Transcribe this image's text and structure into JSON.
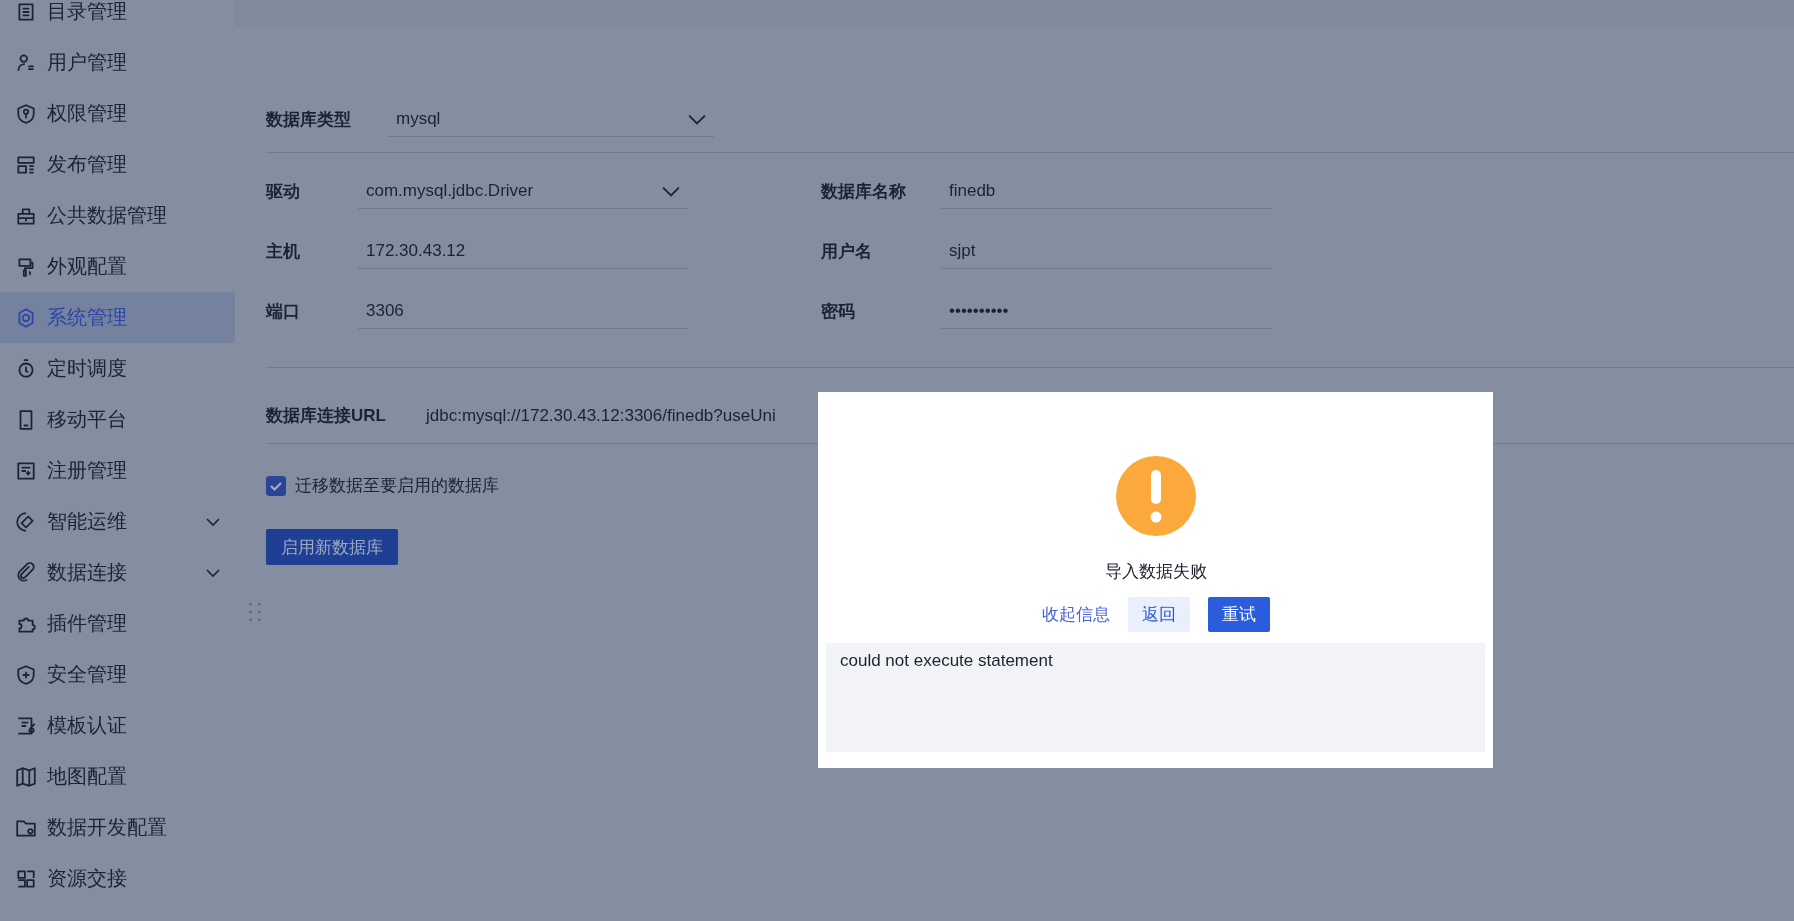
{
  "sidebar": {
    "items": [
      {
        "label": "目录管理",
        "selected": false
      },
      {
        "label": "用户管理",
        "selected": false
      },
      {
        "label": "权限管理",
        "selected": false
      },
      {
        "label": "发布管理",
        "selected": false
      },
      {
        "label": "公共数据管理",
        "selected": false
      },
      {
        "label": "外观配置",
        "selected": false
      },
      {
        "label": "系统管理",
        "selected": true
      },
      {
        "label": "定时调度",
        "selected": false
      },
      {
        "label": "移动平台",
        "selected": false
      },
      {
        "label": "注册管理",
        "selected": false
      },
      {
        "label": "智能运维",
        "selected": false,
        "expanded": false
      },
      {
        "label": "数据连接",
        "selected": false,
        "expanded": false
      },
      {
        "label": "插件管理",
        "selected": false
      },
      {
        "label": "安全管理",
        "selected": false
      },
      {
        "label": "模板认证",
        "selected": false
      },
      {
        "label": "地图配置",
        "selected": false
      },
      {
        "label": "数据开发配置",
        "selected": false
      },
      {
        "label": "资源交接",
        "selected": false
      }
    ]
  },
  "form": {
    "db_type": {
      "label": "数据库类型",
      "value": "mysql"
    },
    "fields": [
      {
        "label": "驱动",
        "value": "com.mysql.jdbc.Driver",
        "kind": "select"
      },
      {
        "label": "数据库名称",
        "value": "finedb",
        "kind": "text"
      },
      {
        "label": "主机",
        "value": "172.30.43.12",
        "kind": "text"
      },
      {
        "label": "用户名",
        "value": "sjpt",
        "kind": "text"
      },
      {
        "label": "端口",
        "value": "3306",
        "kind": "text"
      },
      {
        "label": "密码",
        "value": "••••••••••",
        "kind": "text"
      }
    ],
    "url": {
      "label": "数据库连接URL",
      "value": "jdbc:mysql://172.30.43.12:3306/finedb?useUni"
    },
    "migrate": {
      "label": "迁移数据至要启用的数据库",
      "checked": true
    },
    "submit": "启用新数据库"
  },
  "dialog": {
    "title": "导入数据失败",
    "link": "收起信息",
    "buttons": [
      {
        "label": "返回",
        "kind": "secondary"
      },
      {
        "label": "重试",
        "kind": "primary"
      }
    ],
    "detail": "could not execute statement"
  }
}
